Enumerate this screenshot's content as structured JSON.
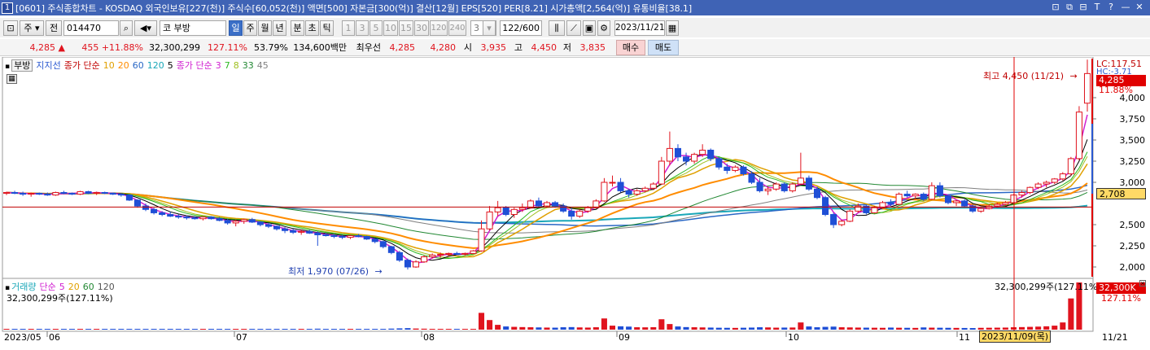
{
  "title": {
    "window_number": "1",
    "text": "[0601] 주식종합차트 - KOSDAQ 외국인보유[227(천)] 주식수[60,052(천)] 액면[500] 자본금[300(억)] 결산[12월] EPS[520] PER[8.21] 시가총액[2,564(억)] 유통비율[38.1]",
    "controls": [
      "⊡",
      "⧉",
      "⊟",
      "T",
      "?",
      "—",
      "✕"
    ]
  },
  "toolbar": {
    "market": "주",
    "prev_label": "전",
    "code": "014470",
    "stock_name": "코 부방",
    "periods": [
      "일",
      "주",
      "월",
      "년",
      "분",
      "초",
      "틱"
    ],
    "selected_period": "일",
    "intervals": [
      "1",
      "3",
      "5",
      "10",
      "15",
      "30",
      "120",
      "240"
    ],
    "interval_value": "3",
    "count": "122",
    "count_max": "/600",
    "date": "2023/11/21"
  },
  "quote": {
    "price": "4,285 ▲",
    "change": "455 +11.88%",
    "volume": "32,300,299",
    "volume_ratio": "127.11%",
    "turnover": "53.79%",
    "amount": "134,600백만",
    "best_bid_label": "최우선",
    "best_ask": "4,285",
    "best_bid": "4,280",
    "open_label": "시",
    "open": "3,935",
    "high_label": "고",
    "high": "4,450",
    "low_label": "저",
    "low": "3,835",
    "buy_label": "매수",
    "sell_label": "매도"
  },
  "legend": {
    "stock": "부방",
    "support": "지지선",
    "ma_close_a": "종가 단순",
    "ma_a": [
      "10",
      "20",
      "60",
      "120",
      "5"
    ],
    "ma_close_b": "종가 단순",
    "ma_b": [
      "3",
      "7",
      "8",
      "33",
      "45"
    ],
    "volume_label": "거래량",
    "vol_ma_label": "단순",
    "vol_ma": [
      "5",
      "20",
      "60",
      "120"
    ],
    "volume_value": "32,300,299주(127.11%)"
  },
  "annotations": {
    "high": "최고 4,450 (11/21)",
    "low": "최저 1,970 (07/26)",
    "lc": "LC:117.51",
    "hc": "HC:-3.71",
    "price_box": "4,285",
    "pct_box": "11.88%",
    "support_box": "2,708",
    "vol_box": "32,300K",
    "vol_pct": "127.11%",
    "vol_right": "32,300,299주(127.11%)",
    "crosshair_date": "2023/11/09(목)"
  },
  "colors": {
    "up": "#e0141e",
    "down": "#1f4fd6",
    "ma10": "#e0a000",
    "ma20": "#ff8c00",
    "ma60": "#2a68c6",
    "ma120": "#1aa7b8",
    "ma5": "#000000",
    "ma3": "#d01fd0",
    "ma7": "#2ab820",
    "ma8": "#a0c020",
    "ma33": "#228833",
    "ma45": "#808080",
    "support": "#c00000"
  },
  "chart_data": {
    "type": "candlestick",
    "y_ticks": [
      "4,000",
      "3,750",
      "3,500",
      "3,250",
      "3,000",
      "2,500",
      "2,250",
      "2,000"
    ],
    "ylim": [
      1900,
      4600
    ],
    "x_labels": [
      "2023/05",
      "06",
      "07",
      "08",
      "09",
      "10",
      "11",
      "11/21"
    ],
    "support_level": 2708,
    "high_point": {
      "date": "11/21",
      "value": 4450
    },
    "low_point": {
      "date": "07/26",
      "value": 1970
    },
    "candles": [
      [
        2870,
        2890,
        2850,
        2880
      ],
      [
        2880,
        2900,
        2860,
        2870
      ],
      [
        2870,
        2890,
        2840,
        2860
      ],
      [
        2860,
        2880,
        2830,
        2870
      ],
      [
        2870,
        2880,
        2850,
        2860
      ],
      [
        2860,
        2880,
        2840,
        2850
      ],
      [
        2850,
        2890,
        2840,
        2880
      ],
      [
        2880,
        2900,
        2860,
        2870
      ],
      [
        2870,
        2880,
        2850,
        2860
      ],
      [
        2860,
        2900,
        2850,
        2890
      ],
      [
        2890,
        2900,
        2860,
        2870
      ],
      [
        2870,
        2890,
        2850,
        2880
      ],
      [
        2880,
        2890,
        2860,
        2870
      ],
      [
        2870,
        2880,
        2850,
        2860
      ],
      [
        2860,
        2870,
        2830,
        2850
      ],
      [
        2850,
        2860,
        2780,
        2790
      ],
      [
        2790,
        2800,
        2700,
        2720
      ],
      [
        2720,
        2750,
        2660,
        2680
      ],
      [
        2680,
        2700,
        2620,
        2640
      ],
      [
        2640,
        2660,
        2600,
        2620
      ],
      [
        2620,
        2650,
        2590,
        2600
      ],
      [
        2600,
        2620,
        2570,
        2590
      ],
      [
        2590,
        2610,
        2560,
        2580
      ],
      [
        2580,
        2600,
        2560,
        2570
      ],
      [
        2570,
        2600,
        2550,
        2590
      ],
      [
        2590,
        2600,
        2560,
        2570
      ],
      [
        2570,
        2590,
        2540,
        2550
      ],
      [
        2550,
        2570,
        2500,
        2520
      ],
      [
        2520,
        2560,
        2480,
        2540
      ],
      [
        2540,
        2570,
        2510,
        2560
      ],
      [
        2560,
        2580,
        2520,
        2530
      ],
      [
        2530,
        2540,
        2480,
        2500
      ],
      [
        2500,
        2520,
        2460,
        2480
      ],
      [
        2480,
        2490,
        2430,
        2450
      ],
      [
        2450,
        2470,
        2400,
        2430
      ],
      [
        2430,
        2450,
        2390,
        2410
      ],
      [
        2410,
        2440,
        2380,
        2420
      ],
      [
        2420,
        2440,
        2390,
        2400
      ],
      [
        2400,
        2420,
        2250,
        2380
      ],
      [
        2380,
        2400,
        2360,
        2370
      ],
      [
        2370,
        2390,
        2340,
        2360
      ],
      [
        2360,
        2380,
        2330,
        2350
      ],
      [
        2350,
        2380,
        2330,
        2370
      ],
      [
        2370,
        2390,
        2350,
        2360
      ],
      [
        2360,
        2370,
        2320,
        2330
      ],
      [
        2330,
        2340,
        2280,
        2300
      ],
      [
        2300,
        2310,
        2220,
        2240
      ],
      [
        2240,
        2250,
        2150,
        2170
      ],
      [
        2170,
        2190,
        2060,
        2080
      ],
      [
        2080,
        2100,
        1970,
        2000
      ],
      [
        2000,
        2080,
        1990,
        2060
      ],
      [
        2060,
        2140,
        2050,
        2120
      ],
      [
        2120,
        2160,
        2100,
        2140
      ],
      [
        2140,
        2170,
        2110,
        2150
      ],
      [
        2150,
        2170,
        2130,
        2160
      ],
      [
        2160,
        2180,
        2140,
        2150
      ],
      [
        2150,
        2170,
        2130,
        2160
      ],
      [
        2160,
        2200,
        2150,
        2190
      ],
      [
        2190,
        2550,
        2180,
        2450
      ],
      [
        2450,
        2720,
        2430,
        2650
      ],
      [
        2650,
        2780,
        2600,
        2700
      ],
      [
        2700,
        2720,
        2600,
        2620
      ],
      [
        2620,
        2700,
        2580,
        2680
      ],
      [
        2680,
        2750,
        2650,
        2700
      ],
      [
        2700,
        2800,
        2690,
        2780
      ],
      [
        2780,
        2820,
        2700,
        2720
      ],
      [
        2720,
        2780,
        2700,
        2760
      ],
      [
        2760,
        2780,
        2700,
        2720
      ],
      [
        2720,
        2750,
        2640,
        2660
      ],
      [
        2660,
        2700,
        2560,
        2600
      ],
      [
        2600,
        2680,
        2580,
        2660
      ],
      [
        2660,
        2720,
        2640,
        2700
      ],
      [
        2700,
        2800,
        2690,
        2780
      ],
      [
        2780,
        3050,
        2770,
        3000
      ],
      [
        3000,
        3080,
        2950,
        3000
      ],
      [
        3000,
        3050,
        2880,
        2900
      ],
      [
        2900,
        2920,
        2820,
        2860
      ],
      [
        2860,
        2920,
        2840,
        2900
      ],
      [
        2900,
        2950,
        2880,
        2930
      ],
      [
        2930,
        3000,
        2910,
        2980
      ],
      [
        2980,
        3300,
        2970,
        3250
      ],
      [
        3250,
        3600,
        3200,
        3400
      ],
      [
        3400,
        3450,
        3250,
        3300
      ],
      [
        3300,
        3350,
        3200,
        3250
      ],
      [
        3250,
        3350,
        3220,
        3330
      ],
      [
        3330,
        3450,
        3300,
        3380
      ],
      [
        3380,
        3400,
        3250,
        3280
      ],
      [
        3280,
        3300,
        3150,
        3180
      ],
      [
        3180,
        3220,
        3100,
        3140
      ],
      [
        3140,
        3200,
        3120,
        3180
      ],
      [
        3180,
        3200,
        3080,
        3100
      ],
      [
        3100,
        3130,
        2980,
        3000
      ],
      [
        3000,
        3050,
        2880,
        2900
      ],
      [
        2900,
        2950,
        2850,
        2920
      ],
      [
        2920,
        3000,
        2900,
        2980
      ],
      [
        2980,
        3000,
        2880,
        2900
      ],
      [
        2900,
        3000,
        2880,
        2980
      ],
      [
        2980,
        3350,
        2970,
        3050
      ],
      [
        3050,
        3080,
        2900,
        2920
      ],
      [
        2920,
        2950,
        2800,
        2820
      ],
      [
        2820,
        2840,
        2600,
        2620
      ],
      [
        2620,
        2640,
        2460,
        2500
      ],
      [
        2500,
        2560,
        2480,
        2540
      ],
      [
        2540,
        2680,
        2530,
        2660
      ],
      [
        2660,
        2750,
        2640,
        2720
      ],
      [
        2720,
        2740,
        2620,
        2640
      ],
      [
        2640,
        2720,
        2630,
        2700
      ],
      [
        2700,
        2780,
        2690,
        2760
      ],
      [
        2760,
        2800,
        2720,
        2740
      ],
      [
        2740,
        2880,
        2730,
        2860
      ],
      [
        2860,
        2900,
        2820,
        2840
      ],
      [
        2840,
        2870,
        2800,
        2860
      ],
      [
        2860,
        2880,
        2780,
        2800
      ],
      [
        2800,
        3000,
        2790,
        2960
      ],
      [
        2960,
        3000,
        2820,
        2840
      ],
      [
        2840,
        2860,
        2740,
        2760
      ],
      [
        2760,
        2790,
        2720,
        2780
      ],
      [
        2780,
        2800,
        2700,
        2720
      ],
      [
        2720,
        2740,
        2640,
        2660
      ],
      [
        2660,
        2700,
        2640,
        2690
      ],
      [
        2690,
        2740,
        2680,
        2720
      ],
      [
        2720,
        2760,
        2700,
        2740
      ],
      [
        2740,
        2780,
        2720,
        2760
      ],
      [
        2760,
        2860,
        2750,
        2850
      ],
      [
        2850,
        2900,
        2820,
        2880
      ],
      [
        2880,
        2950,
        2860,
        2940
      ],
      [
        2940,
        3000,
        2920,
        2980
      ],
      [
        2980,
        3020,
        2940,
        3000
      ],
      [
        3000,
        3050,
        2980,
        3040
      ],
      [
        3040,
        3120,
        3020,
        3100
      ],
      [
        3100,
        3300,
        3080,
        3280
      ],
      [
        3280,
        3900,
        3260,
        3830
      ],
      [
        3935,
        4450,
        3835,
        4285
      ]
    ],
    "volumes": [
      60,
      50,
      55,
      48,
      40,
      45,
      52,
      50,
      44,
      58,
      46,
      42,
      40,
      38,
      45,
      70,
      90,
      75,
      60,
      55,
      50,
      48,
      45,
      40,
      44,
      42,
      50,
      66,
      58,
      52,
      48,
      54,
      62,
      70,
      68,
      60,
      55,
      50,
      120,
      64,
      60,
      56,
      52,
      50,
      62,
      80,
      98,
      130,
      160,
      190,
      140,
      120,
      100,
      90,
      85,
      80,
      78,
      90,
      2100,
      1200,
      600,
      400,
      350,
      320,
      300,
      280,
      260,
      250,
      300,
      320,
      280,
      260,
      300,
      1400,
      500,
      420,
      380,
      300,
      290,
      310,
      1300,
      700,
      400,
      320,
      300,
      280,
      260,
      240,
      230,
      220,
      240,
      260,
      300,
      280,
      250,
      260,
      270,
      900,
      400,
      300,
      350,
      380,
      300,
      280,
      260,
      250,
      240,
      230,
      260,
      240,
      230,
      220,
      280,
      250,
      240,
      230,
      220,
      210,
      200,
      230,
      240,
      250,
      260,
      300,
      320,
      350,
      380,
      420,
      500,
      900,
      3900,
      5900
    ]
  }
}
